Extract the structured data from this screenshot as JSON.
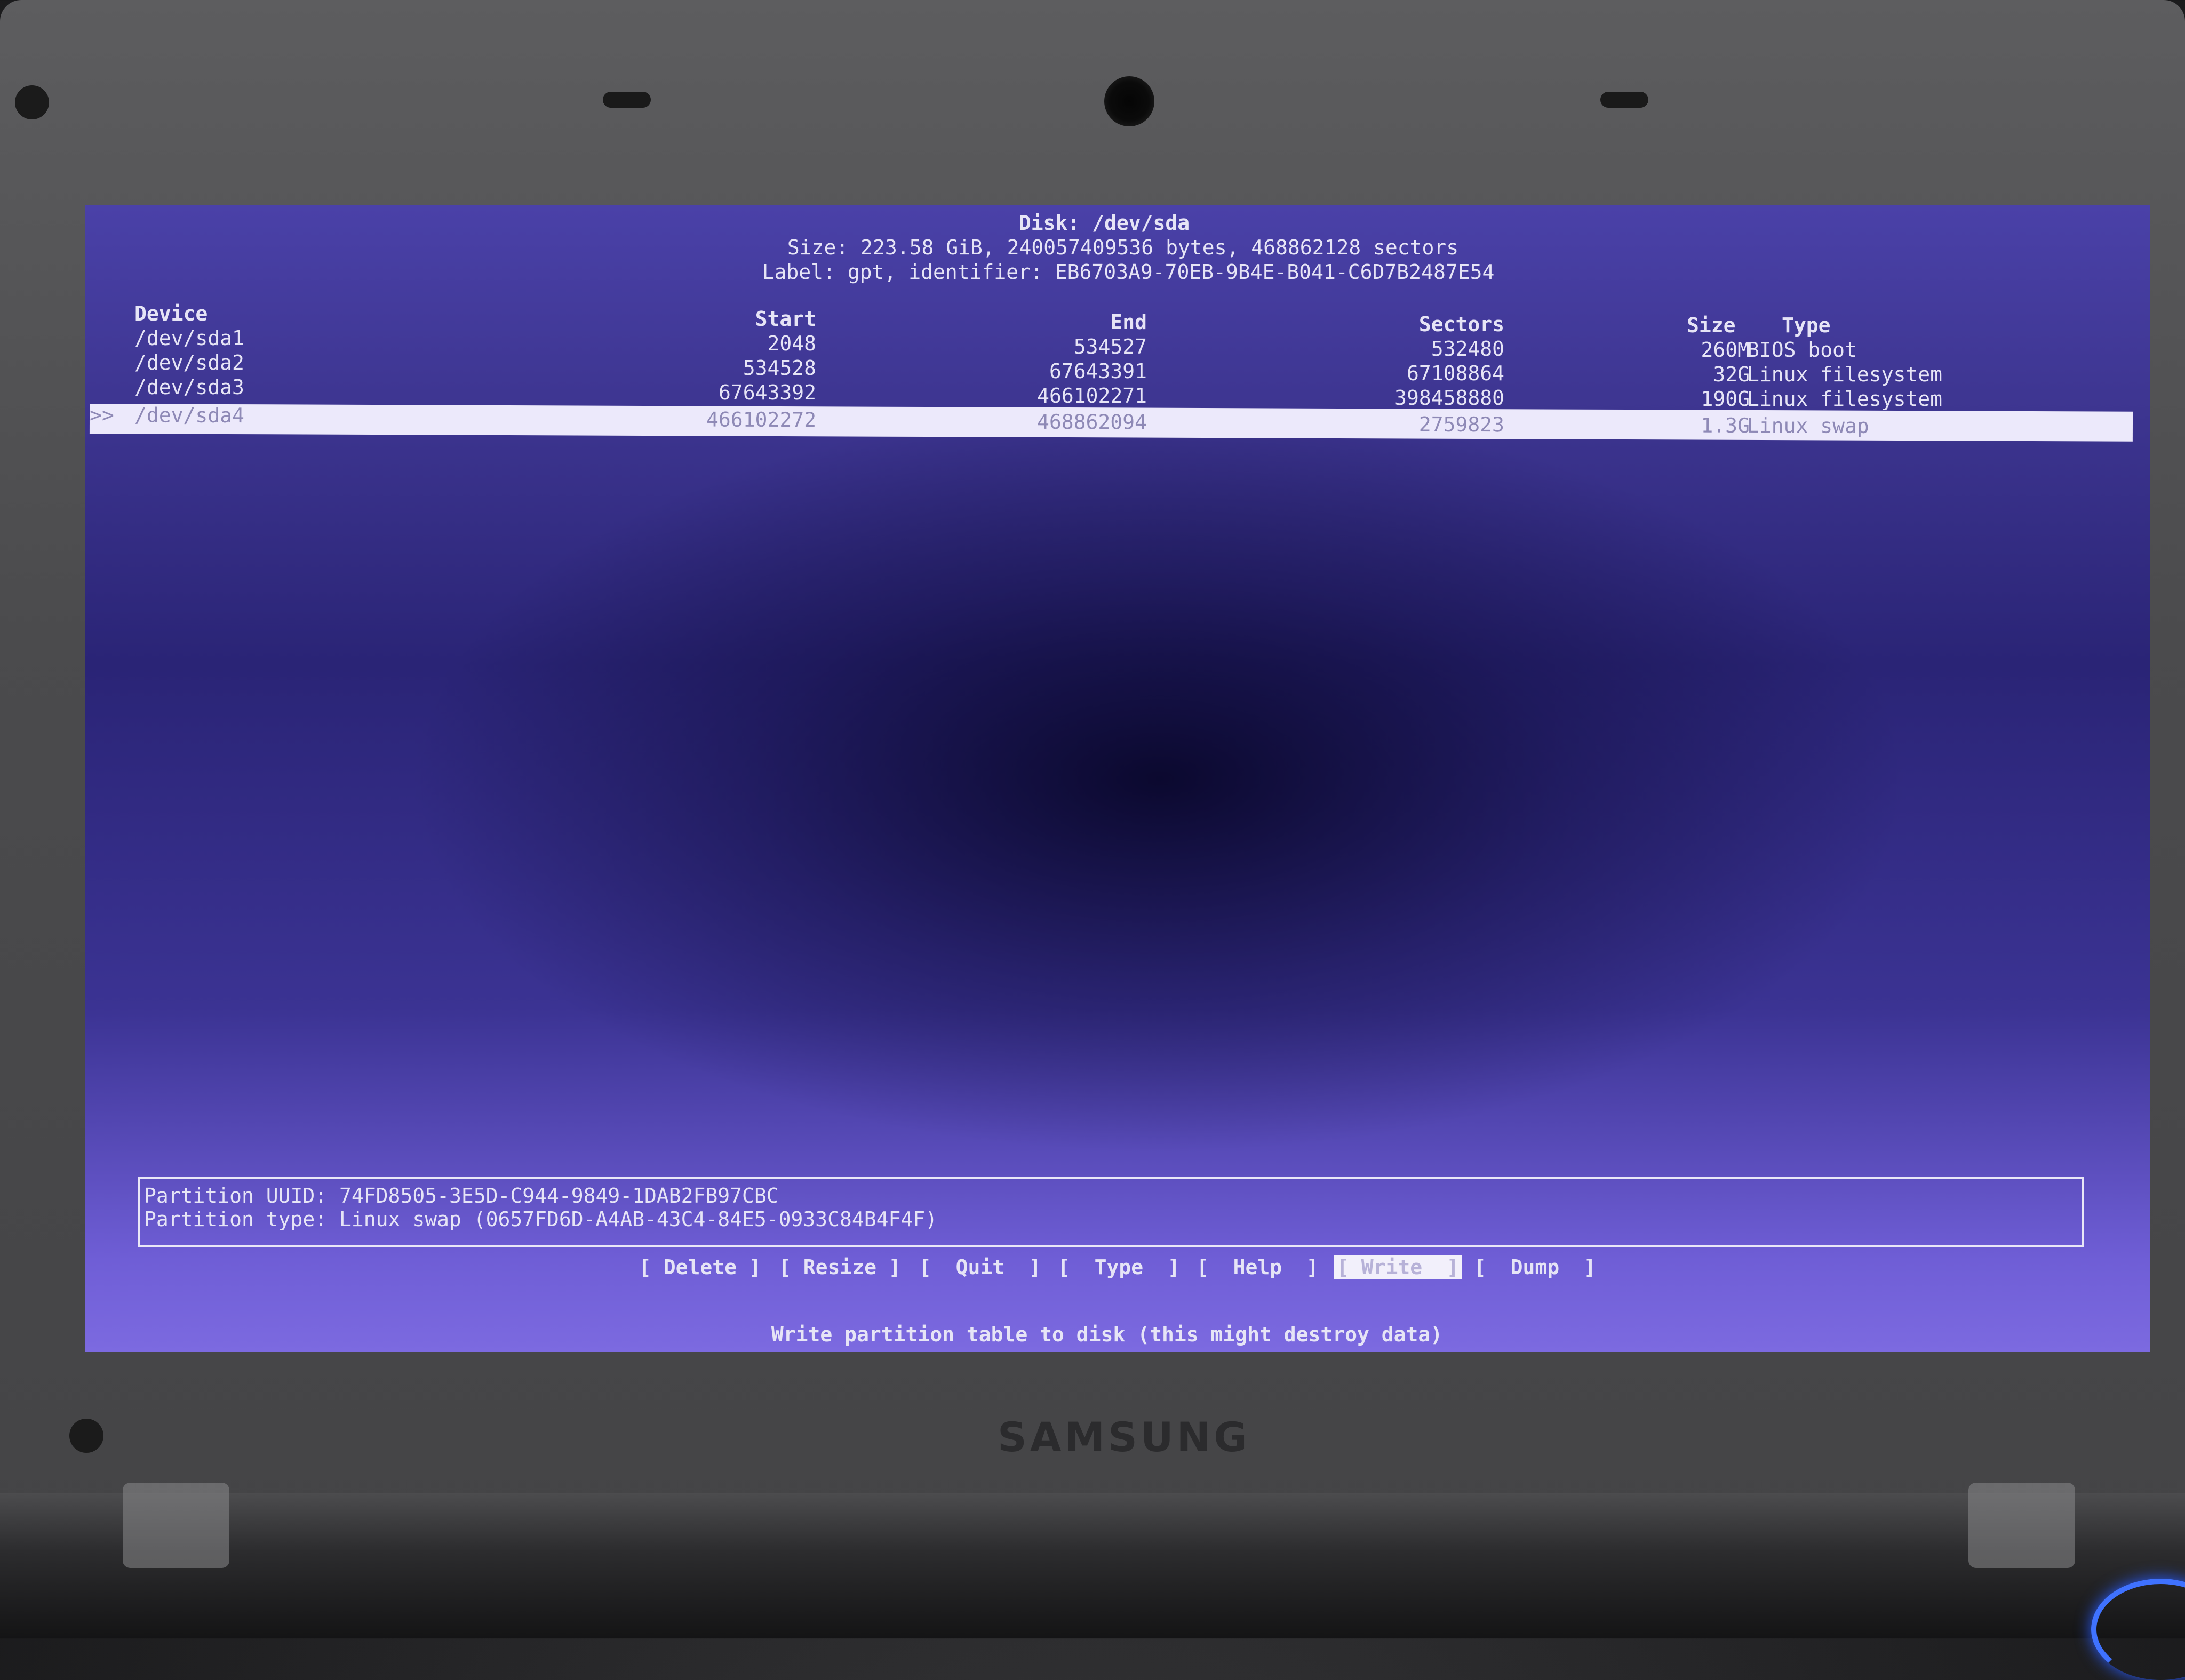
{
  "disk": {
    "title": "Disk: /dev/sda",
    "size_line": "Size: 223.58 GiB, 240057409536 bytes, 468862128 sectors",
    "label_line": "Label: gpt, identifier: EB6703A9-70EB-9B4E-B041-C6D7B2487E54"
  },
  "table": {
    "headers": {
      "device": "Device",
      "start": "Start",
      "end": "End",
      "sectors": "Sectors",
      "size": "Size",
      "type": "Type"
    },
    "rows": [
      {
        "device": "/dev/sda1",
        "start": "2048",
        "end": "534527",
        "sectors": "532480",
        "size": "260M",
        "type": "BIOS boot"
      },
      {
        "device": "/dev/sda2",
        "start": "534528",
        "end": "67643391",
        "sectors": "67108864",
        "size": "32G",
        "type": "Linux filesystem"
      },
      {
        "device": "/dev/sda3",
        "start": "67643392",
        "end": "466102271",
        "sectors": "398458880",
        "size": "190G",
        "type": "Linux filesystem"
      },
      {
        "device": "/dev/sda4",
        "start": "466102272",
        "end": "468862094",
        "sectors": "2759823",
        "size": "1.3G",
        "type": "Linux swap"
      }
    ],
    "selected_marker": ">>"
  },
  "info": {
    "uuid_line": "Partition UUID: 74FD8505-3E5D-C944-9849-1DAB2FB97CBC",
    "type_line": "Partition type: Linux swap (0657FD6D-A4AB-43C4-84E5-0933C84B4F4F)"
  },
  "menu": {
    "delete": "[ Delete ]",
    "resize": "[ Resize ]",
    "quit": "[  Quit  ]",
    "type": "[  Type  ]",
    "help": "[  Help  ]",
    "write": "[ Write  ]",
    "dump": "[  Dump  ]"
  },
  "status": "Write partition table to disk (this might destroy data)",
  "bezel": {
    "brand": "SAMSUNG"
  },
  "colors": {
    "screen_bg": "#3d3590",
    "text": "#e6e4f6",
    "highlight": "#ece9fb",
    "power_led": "#3f72ff"
  }
}
